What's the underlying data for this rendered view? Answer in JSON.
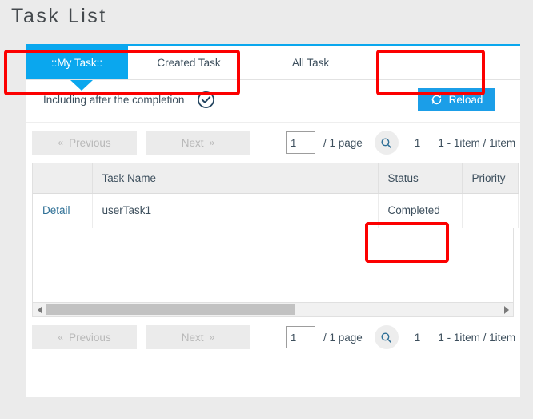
{
  "page": {
    "title": "Task List"
  },
  "tabs": [
    {
      "label": "::My Task::",
      "active": true
    },
    {
      "label": "Created Task",
      "active": false
    },
    {
      "label": "All Task",
      "active": false
    }
  ],
  "toolbar": {
    "include_completed_label": "Including after the completion",
    "include_completed_icon": "circle-check-icon",
    "reload_label": "Reload",
    "reload_icon": "refresh-icon"
  },
  "pagination": {
    "previous_label": "Previous",
    "previous_chevron": "«",
    "next_label": "Next",
    "next_chevron": "»",
    "page_input_value": "1",
    "page_total_label": "/  1 page",
    "search_icon": "search-icon",
    "current_page": "1",
    "range_label": "1 - 1item / 1item"
  },
  "table": {
    "columns": [
      "",
      "Task Name",
      "Status",
      "Priority"
    ],
    "rows": [
      {
        "detail": "Detail",
        "task_name": "userTask1",
        "status": "Completed",
        "priority": ""
      }
    ]
  },
  "colors": {
    "accent_blue": "#0aa7ee",
    "button_blue": "#1b9ee8",
    "highlight_red": "#fc0000",
    "page_background": "#ebebeb",
    "panel_background": "#ffffff",
    "text": "#3d4f5d",
    "disabled_text": "#b8b8b8"
  }
}
